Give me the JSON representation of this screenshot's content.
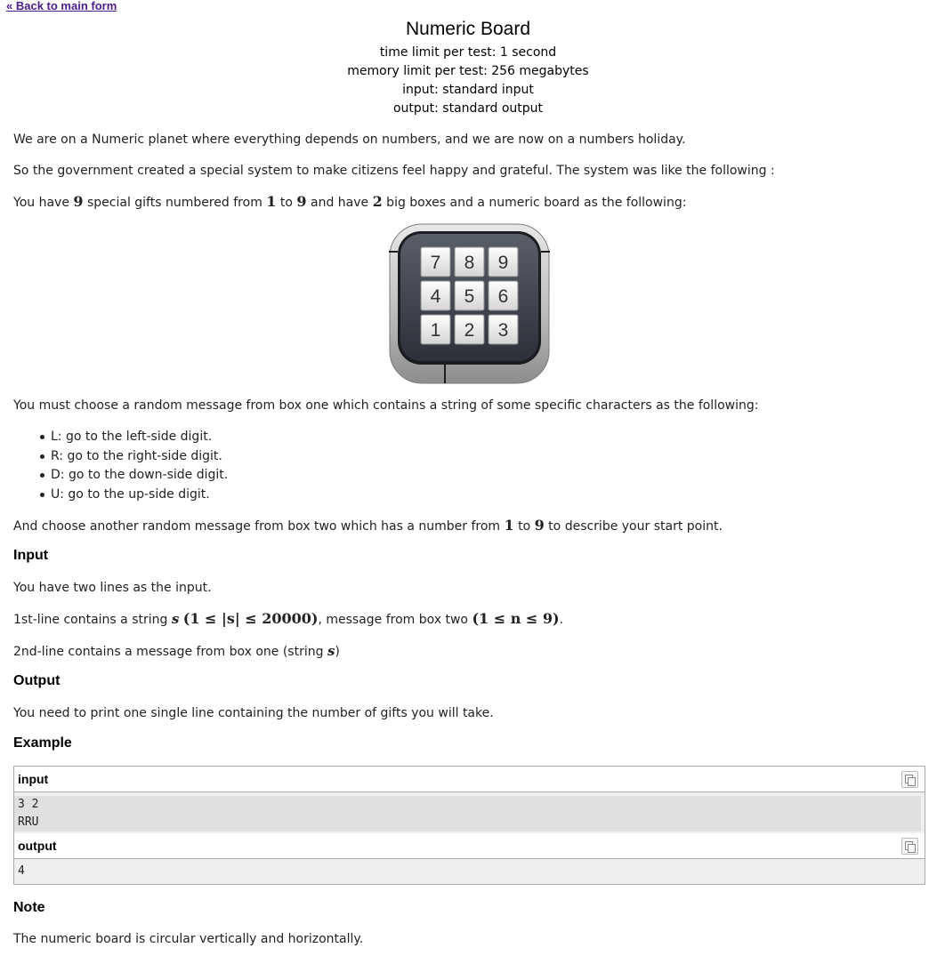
{
  "nav": {
    "back_label": "« Back to main form"
  },
  "problem": {
    "title": "Numeric Board",
    "time_limit": "time limit per test: 1 second",
    "memory_limit": "memory limit per test: 256 megabytes",
    "input": "input: standard input",
    "output": "output: standard output"
  },
  "statement": {
    "p1": "We are on a Numeric planet where everything depends on numbers, and we are now on a numbers holiday.",
    "p2": "So the government created a special system to make citizens feel happy and grateful. The system was like the following :",
    "p3": {
      "a": "You have ",
      "m1": "9",
      "b": " special gifts numbered from ",
      "m2": "1",
      "c": " to ",
      "m3": "9",
      "d": " and have ",
      "m4": "2",
      "e": " big boxes and a numeric board as the following:"
    },
    "board_keys": [
      "7",
      "8",
      "9",
      "4",
      "5",
      "6",
      "1",
      "2",
      "3"
    ],
    "p4": "You must choose a random message from box one which contains a string of some specific characters as the following:",
    "bullets": [
      "L: go to the left-side digit.",
      "R: go to the right-side digit.",
      "D: go to the down-side digit.",
      "U: go to the up-side digit."
    ],
    "p5": {
      "a": "And choose another random message from box two which has a number from ",
      "m1": "1",
      "b": " to ",
      "m2": "9",
      "c": " to describe your start point."
    }
  },
  "input_section": {
    "title": "Input",
    "p1": "You have two lines as the input.",
    "p2": {
      "a": "1st-line contains a string ",
      "m1": "s",
      "m2": "(1 ≤ |s| ≤ 20000)",
      "b": ", message from box two ",
      "m3": "(1 ≤ n ≤ 9)",
      "c": "."
    },
    "p3": {
      "a": "2nd-line contains a message from box one (string ",
      "m1": "s",
      "b": ")"
    }
  },
  "output_section": {
    "title": "Output",
    "p1": "You need to print one single line containing the number of gifts you will take."
  },
  "example": {
    "title": "Example",
    "input_label": "input",
    "input_lines": [
      "3 2",
      "RRU"
    ],
    "output_label": "output",
    "output_lines": [
      "4"
    ]
  },
  "note": {
    "title": "Note",
    "p1": "The numeric board is circular vertically and horizontally."
  }
}
